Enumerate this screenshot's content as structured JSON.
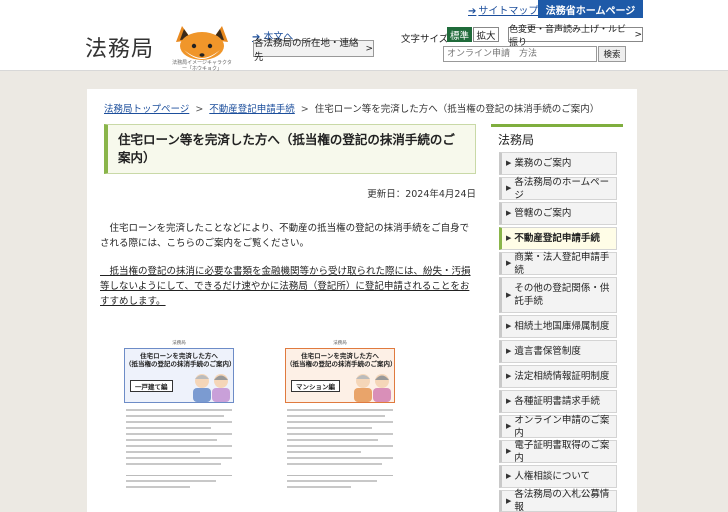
{
  "header": {
    "sitemap_label": "サイトマップ",
    "moj_home_label": "法務省ホームページ",
    "logo_text": "法務局",
    "mascot_caption": "法務局イメージキャラクター「ホウキョク」",
    "honbun_label": "本文へ",
    "locations_button": "各法務局の所在地・連絡先",
    "font_size_label": "文字サイズ",
    "font_standard": "標準",
    "font_large": "拡大",
    "color_change_button": "色変更・音声読み上げ・ルビ振り",
    "search_placeholder": "オンライン申請　方法",
    "search_button": "検索"
  },
  "breadcrumb": {
    "home": "法務局トップページ",
    "parent": "不動産登記申請手続",
    "current": "住宅ローン等を完済した方へ（抵当権の登記の抹消手続のご案内）",
    "separator": ">"
  },
  "page": {
    "title": "住宅ローン等を完済した方へ（抵当権の登記の抹消手続のご案内）",
    "updated": "更新日：2024年4月24日",
    "paragraph1": "住宅ローンを完済したことなどにより、不動産の抵当権の登記の抹消手続をご自身でされる際には、こちらのご案内をご覧ください。",
    "paragraph2": "抵当権の登記の抹消に必要な書類を金融機関等から受け取られた際には、紛失・汚損等しないようにして、できるだけ速やかに法務局（登記所）に登記申請されることをおすすめします。"
  },
  "leaflets": [
    {
      "org": "法務局",
      "title": "住宅ローンを完済した方へ\n（抵当権の登記の抹消手続のご案内）",
      "tag": "一戸建て編",
      "accent": "#6d8cc7",
      "bg": "#dde6f6"
    },
    {
      "org": "法務局",
      "title": "住宅ローンを完済した方へ\n（抵当権の登記の抹消手続のご案内）",
      "tag": "マンション編",
      "accent": "#e07a3e",
      "bg": "#fbe3d2"
    }
  ],
  "sidebar": {
    "title": "法務局",
    "items": [
      {
        "label": "業務のご案内"
      },
      {
        "label": "各法務局のホームページ"
      },
      {
        "label": "管轄のご案内"
      },
      {
        "label": "不動産登記申請手続",
        "active": true
      },
      {
        "label": "商業・法人登記申請手続"
      },
      {
        "label": "その他の登記関係・供託手続"
      },
      {
        "label": "相続土地国庫帰属制度"
      },
      {
        "label": "遺言書保管制度"
      },
      {
        "label": "法定相続情報証明制度"
      },
      {
        "label": "各種証明書請求手続"
      },
      {
        "label": "オンライン申請のご案内"
      },
      {
        "label": "電子証明書取得のご案内"
      },
      {
        "label": "人権相談について"
      },
      {
        "label": "各法務局の入札公募情報"
      }
    ]
  },
  "colors": {
    "accent_green": "#8ab54a",
    "standard_green": "#1f6b3a",
    "moj_blue": "#1e5aa8",
    "link_blue": "#1d4f9c"
  }
}
